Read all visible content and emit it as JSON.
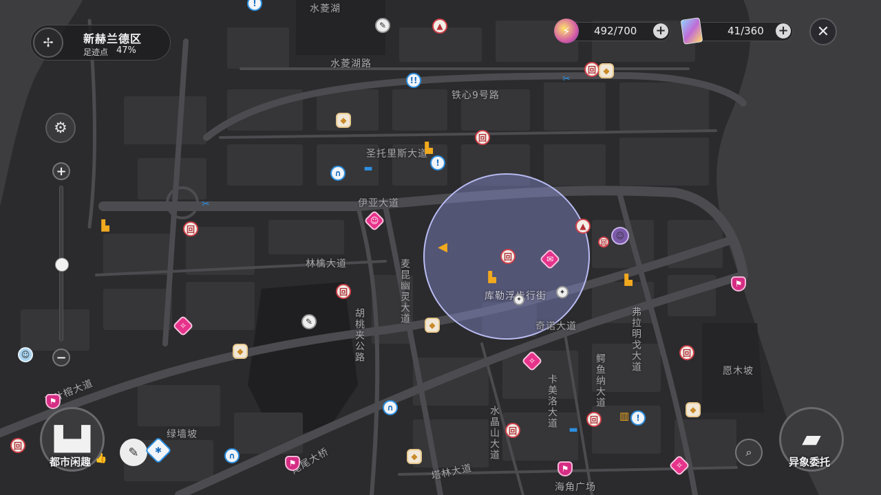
{
  "region": {
    "name": "新赫兰德区",
    "progress_label": "足迹点",
    "progress_value": "47%",
    "progress_fraction": 0.47
  },
  "resources": [
    {
      "icon": "battery-icon",
      "value": "492/700"
    },
    {
      "icon": "card-icon",
      "value": "41/360"
    }
  ],
  "labels": {
    "shuiling_lake": "水菱湖",
    "shuiling_lake_road": "水菱湖路",
    "tiexin_road": "铁心9号路",
    "santorise_ave": "圣托里斯大道",
    "yiya_ave": "伊亚大道",
    "linqin_ave": "林檎大道",
    "maikun_ave": "麦昆幽灵大道",
    "hutao_road": "胡桃夹公路",
    "kulefu_street": "库勒浮步行街",
    "qinuo_ave": "奇诺大道",
    "fulaming_ave": "弗拉明戈大道",
    "eyu_ave": "鳄鱼纳大道",
    "kameiluo_ave": "卡美洛大道",
    "shuijing_ave": "水晶山大道",
    "yuanmu_slope": "愿木坡",
    "lvqiang_slope": "绿墙坡",
    "banye_ave": "半叶榕大道",
    "weiwei_bridge": "尾尾大桥",
    "talin_ave": "塔林大道",
    "haijiao_plaza": "海角广场"
  },
  "buttons": {
    "city_leisure": "都市闲趣",
    "anomaly_commission": "异象委托"
  },
  "zoom": {
    "level": 0.5
  },
  "colors": {
    "accent_red": "#d2404a",
    "accent_blue": "#2d8fe0",
    "accent_pink": "#e7338b",
    "region_circle": "#8b8fd8"
  }
}
